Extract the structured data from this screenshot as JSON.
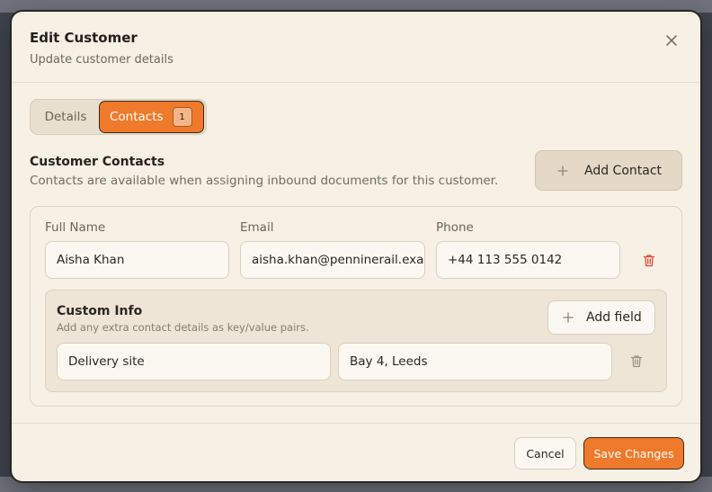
{
  "modal": {
    "title": "Edit Customer",
    "subtitle": "Update customer details"
  },
  "tabs": [
    {
      "label": "Details",
      "active": false
    },
    {
      "label": "Contacts",
      "active": true,
      "count": "1"
    }
  ],
  "section": {
    "title": "Customer Contacts",
    "description": "Contacts are available when assigning inbound documents for this customer.",
    "add_contact_label": "Add Contact"
  },
  "contact": {
    "full_name_label": "Full Name",
    "full_name_value": "Aisha Khan",
    "email_label": "Email",
    "email_value": "aisha.khan@penninerail.exa",
    "phone_label": "Phone",
    "phone_value": "+44 113 555 0142"
  },
  "custom_info": {
    "title": "Custom Info",
    "description": "Add any extra contact details as key/value pairs.",
    "add_field_label": "Add field",
    "fields": [
      {
        "key": "Delivery site",
        "value": "Bay 4, Leeds"
      }
    ]
  },
  "footer": {
    "cancel_label": "Cancel",
    "save_label": "Save Changes"
  },
  "colors": {
    "accent": "#f07a2b",
    "danger": "#e0483a",
    "background": "#f7f0e4"
  },
  "icons": {
    "close": "close-icon",
    "plus": "plus-icon",
    "trash": "trash-icon"
  }
}
